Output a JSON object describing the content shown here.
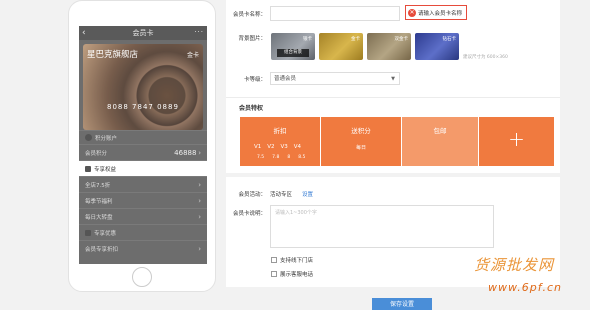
{
  "phone": {
    "header_title": "会员卡",
    "back_icon": "‹",
    "more_icon": "···",
    "card": {
      "shop_name": "星巴克旗舰店",
      "level": "金卡",
      "number": "8088 7847 0889"
    },
    "sections": [
      {
        "title": "积分账户",
        "rows": [
          {
            "label": "会员积分",
            "value": "46888"
          }
        ]
      },
      {
        "title": "专享权益",
        "rows": [
          {
            "label": "全店7.5折",
            "value": ""
          },
          {
            "label": "每季节福利",
            "value": ""
          },
          {
            "label": "每日大转盘",
            "value": ""
          }
        ]
      },
      {
        "title": "专享优惠",
        "rows": [
          {
            "label": "会员专享折扣",
            "value": ""
          }
        ]
      }
    ]
  },
  "form": {
    "card_name_label": "会员卡名称：",
    "card_name_value": "",
    "card_name_error": "请输入会员卡名称",
    "background_label": "背景图片：",
    "backgrounds": [
      {
        "label": "银卡",
        "caption": "组合背景",
        "color": "#8a8f96"
      },
      {
        "label": "金卡",
        "caption": "",
        "color": "#c9a236"
      },
      {
        "label": "双金卡",
        "caption": "",
        "color": "#9a8b6b"
      },
      {
        "label": "钻石卡",
        "caption": "",
        "color": "#3d4ea8"
      }
    ],
    "size_hint": "建议尺寸为 600×360",
    "level_label": "卡等级：",
    "level_value": "普通会员"
  },
  "benefits": {
    "title": "会员特权",
    "tiles": [
      {
        "title": "折扣",
        "levels": [
          "V1",
          "V2",
          "V3",
          "V4"
        ],
        "discounts": [
          "7.5",
          "7.8",
          "8",
          "8.5"
        ]
      },
      {
        "title": "送积分",
        "sub": "每日"
      },
      {
        "title": "包邮"
      },
      {
        "title": "+"
      }
    ]
  },
  "extra": {
    "activity_label": "会员活动：",
    "activity_value": "活动专区",
    "activity_link": "设置",
    "desc_label": "会员卡说明：",
    "desc_placeholder": "请输入1~300个字",
    "checkbox_1": "支持线下门店",
    "checkbox_2": "展示客服电话",
    "save_button": "保存设置"
  },
  "watermark": {
    "main": "货源批发网",
    "sub": "www.6pf.cn"
  },
  "colors": {
    "accent": "#f07a3f",
    "accent_light": "#f49a6a",
    "link": "#3a7fd5",
    "error": "#e64b3b",
    "primary_button": "#4a8ed8"
  }
}
